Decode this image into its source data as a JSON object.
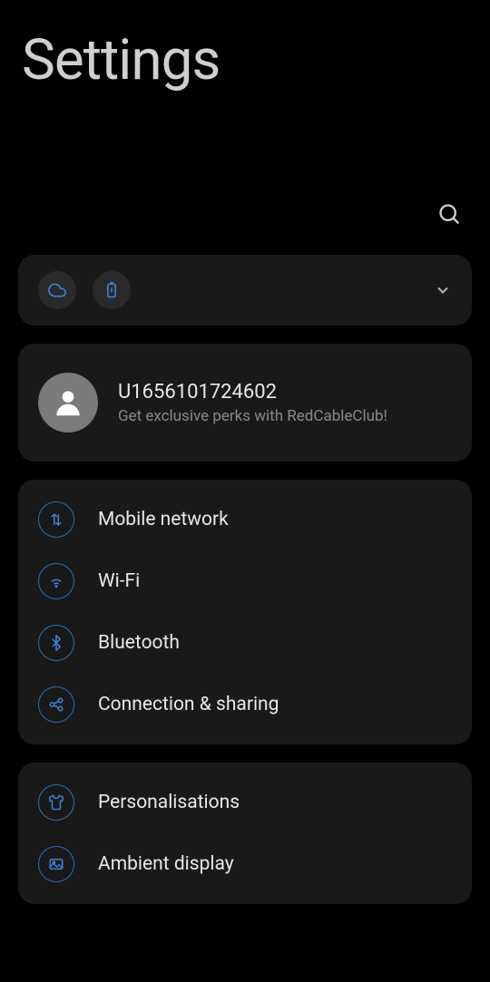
{
  "header": {
    "title": "Settings"
  },
  "account": {
    "id": "U1656101724602",
    "subtitle": "Get exclusive perks with RedCableClub!"
  },
  "groups": [
    {
      "items": [
        {
          "key": "mobile-network",
          "label": "Mobile network",
          "icon": "data-arrows"
        },
        {
          "key": "wifi",
          "label": "Wi-Fi",
          "icon": "wifi"
        },
        {
          "key": "bluetooth",
          "label": "Bluetooth",
          "icon": "bluetooth"
        },
        {
          "key": "connection-sharing",
          "label": "Connection & sharing",
          "icon": "share"
        }
      ]
    },
    {
      "items": [
        {
          "key": "personalisations",
          "label": "Personalisations",
          "icon": "shirt"
        },
        {
          "key": "ambient-display",
          "label": "Ambient display",
          "icon": "image"
        }
      ]
    }
  ],
  "colors": {
    "accent": "#3b82d4",
    "cardBg": "#191919"
  }
}
